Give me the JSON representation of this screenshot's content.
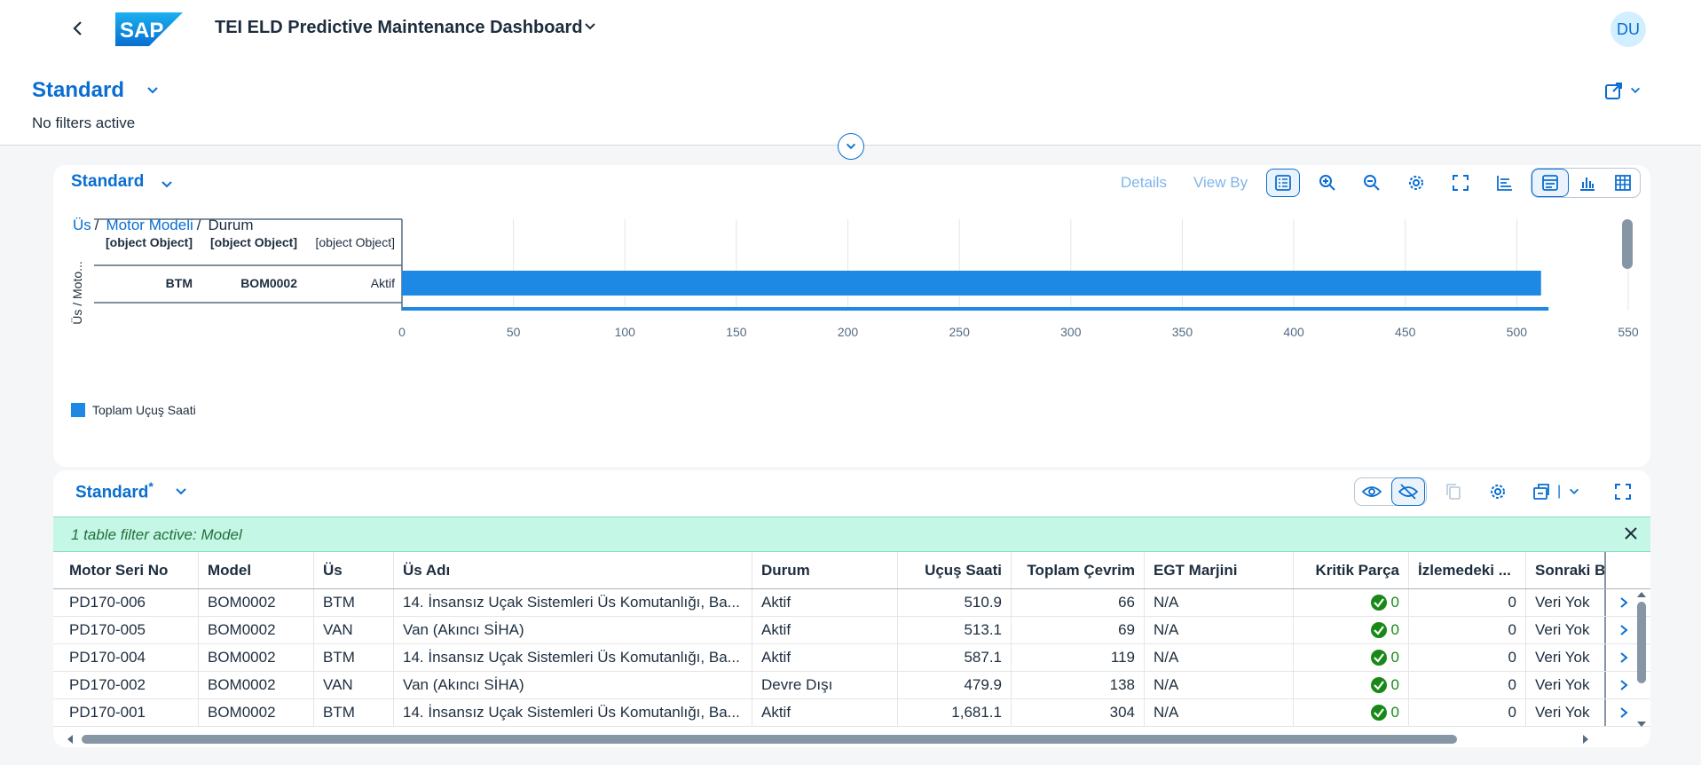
{
  "shell": {
    "logo_text": "SAP",
    "title": "TEI ELD Predictive Maintenance Dashboard",
    "avatar": "DU",
    "brand_color": "#0a6ed1"
  },
  "header": {
    "variant": "Standard",
    "filter_status": "No filters active"
  },
  "chart_card": {
    "title": "Standard",
    "toolbar": {
      "details": "Details",
      "view_by": "View By"
    },
    "breadcrumb": [
      "Üs",
      "Motor Modeli",
      "Durum"
    ]
  },
  "chart_data": {
    "type": "bar",
    "orientation": "horizontal",
    "y_axis_title": "Üs / Moto...",
    "dimension_headers": [
      "[object Object]",
      "[object Object]",
      "[object Object]"
    ],
    "rows": [
      {
        "labels": [
          "BTM",
          "BOM0002",
          "Aktif"
        ],
        "value": 510.9
      }
    ],
    "x_ticks": [
      "0",
      "50",
      "100",
      "150",
      "200",
      "250",
      "300",
      "350",
      "400",
      "450",
      "500",
      "550"
    ],
    "xlim": [
      0,
      550
    ],
    "legend": [
      "Toplam Uçuş Saati"
    ],
    "legend_position": "bottom-left",
    "series_color": "#1e88e5",
    "grid": true
  },
  "table_card": {
    "title": "Standard",
    "modified_marker": "*",
    "filter_info": "1 table filter active: Model",
    "columns": [
      "Motor Seri No",
      "Model",
      "Üs",
      "Üs Adı",
      "Durum",
      "Uçuş Saati",
      "Toplam Çevrim",
      "EGT Marjini",
      "Kritik Parça",
      "İzlemedeki ...",
      "Sonraki Ba"
    ],
    "rows": [
      [
        "PD170-006",
        "BOM0002",
        "BTM",
        "14. İnsansız Uçak Sistemleri Üs Komutanlığı, Ba...",
        "Aktif",
        "510.9",
        "66",
        "N/A",
        "0",
        "0",
        "Veri Yok"
      ],
      [
        "PD170-005",
        "BOM0002",
        "VAN",
        "Van (Akıncı SİHA)",
        "Aktif",
        "513.1",
        "69",
        "N/A",
        "0",
        "0",
        "Veri Yok"
      ],
      [
        "PD170-004",
        "BOM0002",
        "BTM",
        "14. İnsansız Uçak Sistemleri Üs Komutanlığı, Ba...",
        "Aktif",
        "587.1",
        "119",
        "N/A",
        "0",
        "0",
        "Veri Yok"
      ],
      [
        "PD170-002",
        "BOM0002",
        "VAN",
        "Van (Akıncı SİHA)",
        "Devre Dışı",
        "479.9",
        "138",
        "N/A",
        "0",
        "0",
        "Veri Yok"
      ],
      [
        "PD170-001",
        "BOM0002",
        "BTM",
        "14. İnsansız Uçak Sistemleri Üs Komutanlığı, Ba...",
        "Aktif",
        "1,681.1",
        "304",
        "N/A",
        "0",
        "0",
        "Veri Yok"
      ]
    ],
    "status_color": "#188918"
  }
}
